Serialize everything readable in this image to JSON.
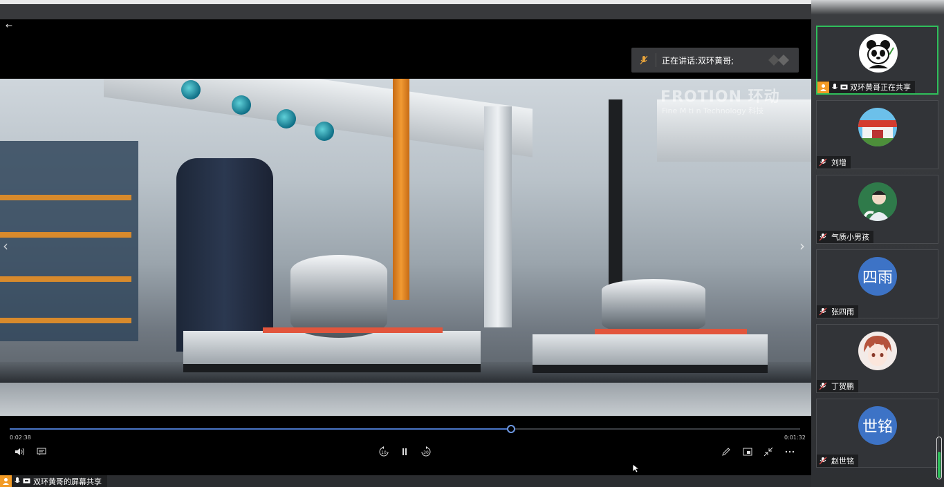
{
  "stage": {
    "speaking_label": "正在讲话:双环黄哥;"
  },
  "video": {
    "watermark_main": "FROTION 环动",
    "watermark_sub": "Fine M  ti  n Technology  科技"
  },
  "player": {
    "elapsed": "0:02:38",
    "remaining": "0:01:32",
    "progress_fraction": 0.634,
    "rewind_label": "10",
    "forward_label": "30"
  },
  "bottom": {
    "share_text": "双环黄哥的屏幕共享"
  },
  "participants": [
    {
      "name": "双环黄哥正在共享",
      "avatar": "panda",
      "active": true,
      "sharing": true
    },
    {
      "name": "刘增",
      "avatar": "school-photo",
      "active": false,
      "sharing": false
    },
    {
      "name": "气质小男孩",
      "avatar": "boy-photo",
      "active": false,
      "sharing": false
    },
    {
      "name": "张四雨",
      "avatar_text": "四雨",
      "active": false,
      "sharing": false
    },
    {
      "name": "丁贺鹏",
      "avatar": "anime-photo",
      "active": false,
      "sharing": false
    },
    {
      "name": "赵世铭",
      "avatar_text": "世铭",
      "active": false,
      "sharing": false
    }
  ],
  "colors": {
    "accent_green": "#2fbf5b",
    "progress_blue": "#4a76c9",
    "share_orange": "#f29b26",
    "avatar_blue": "#3d73c6"
  }
}
